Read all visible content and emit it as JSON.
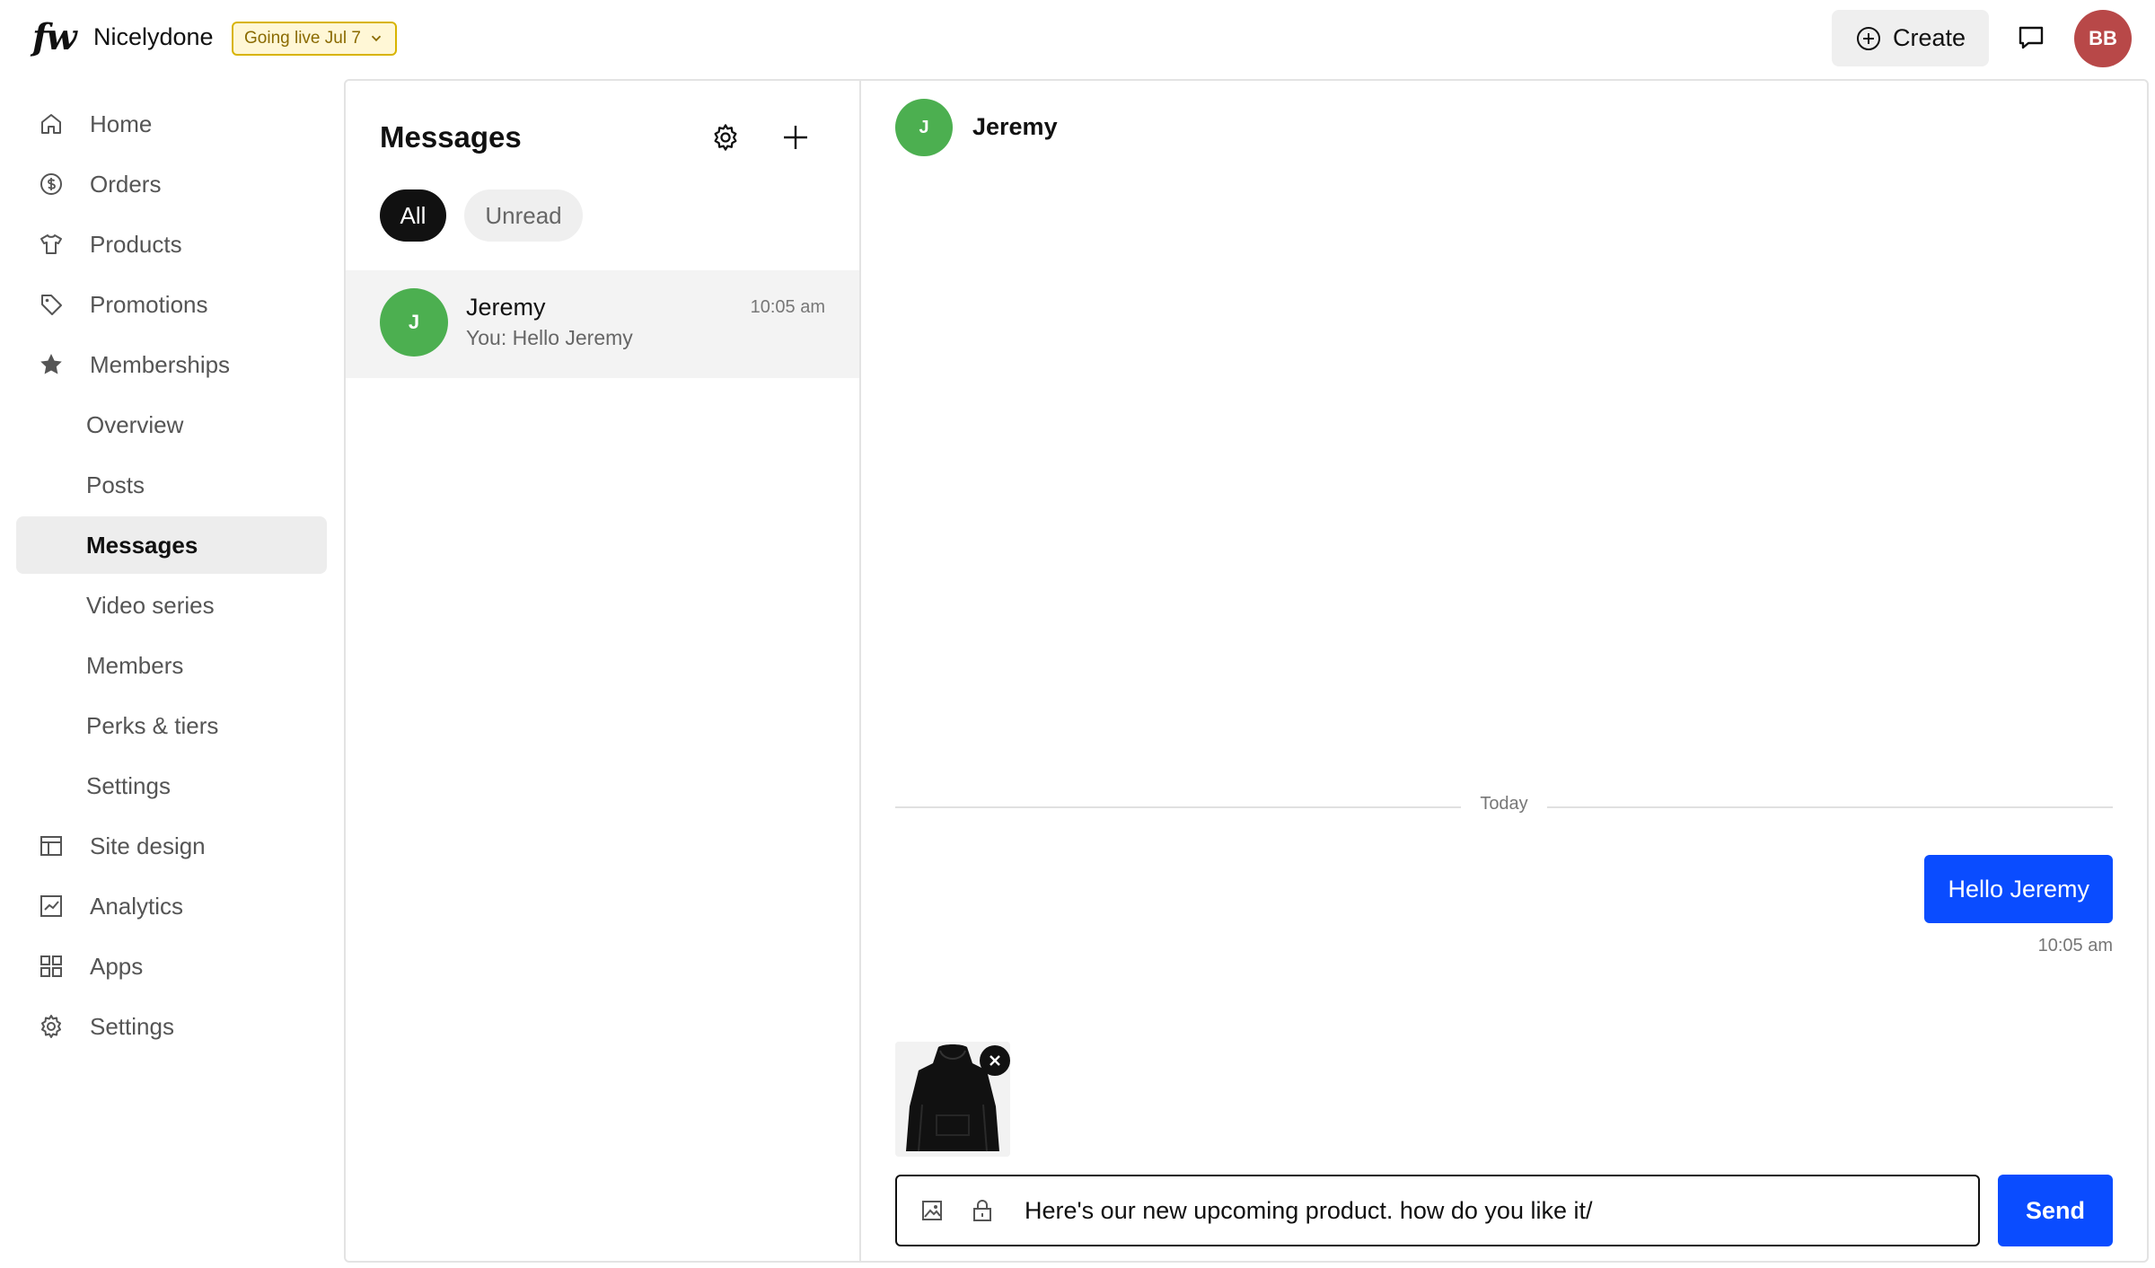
{
  "header": {
    "logo": "fw",
    "shop_name": "Nicelydone",
    "live_badge": "Going live Jul 7",
    "create_label": "Create",
    "user_initials": "BB",
    "avatar_color": "#b84848"
  },
  "sidebar": {
    "items": [
      {
        "label": "Home",
        "icon": "home-icon"
      },
      {
        "label": "Orders",
        "icon": "dollar-circle-icon"
      },
      {
        "label": "Products",
        "icon": "shirt-icon"
      },
      {
        "label": "Promotions",
        "icon": "tag-icon"
      },
      {
        "label": "Memberships",
        "icon": "star-icon"
      },
      {
        "label": "Overview"
      },
      {
        "label": "Posts"
      },
      {
        "label": "Messages",
        "active": true
      },
      {
        "label": "Video series"
      },
      {
        "label": "Members"
      },
      {
        "label": "Perks & tiers"
      },
      {
        "label": "Settings"
      },
      {
        "label": "Site design",
        "icon": "layout-icon"
      },
      {
        "label": "Analytics",
        "icon": "chart-icon"
      },
      {
        "label": "Apps",
        "icon": "grid-icon"
      },
      {
        "label": "Settings",
        "icon": "gear-icon"
      }
    ]
  },
  "messages": {
    "title": "Messages",
    "filters": {
      "all": "All",
      "unread": "Unread"
    },
    "conversations": [
      {
        "initial": "J",
        "name": "Jeremy",
        "preview": "You: Hello Jeremy",
        "time": "10:05 am",
        "avatar_color": "#4caf50"
      }
    ]
  },
  "chat": {
    "contact_initial": "J",
    "contact_name": "Jeremy",
    "day_divider": "Today",
    "messages": [
      {
        "text": "Hello Jeremy",
        "time": "10:05 am",
        "from": "me"
      }
    ],
    "composer_value": "Here's our new upcoming product. how do you like it/",
    "send_label": "Send",
    "accent": "#0a4cff"
  }
}
